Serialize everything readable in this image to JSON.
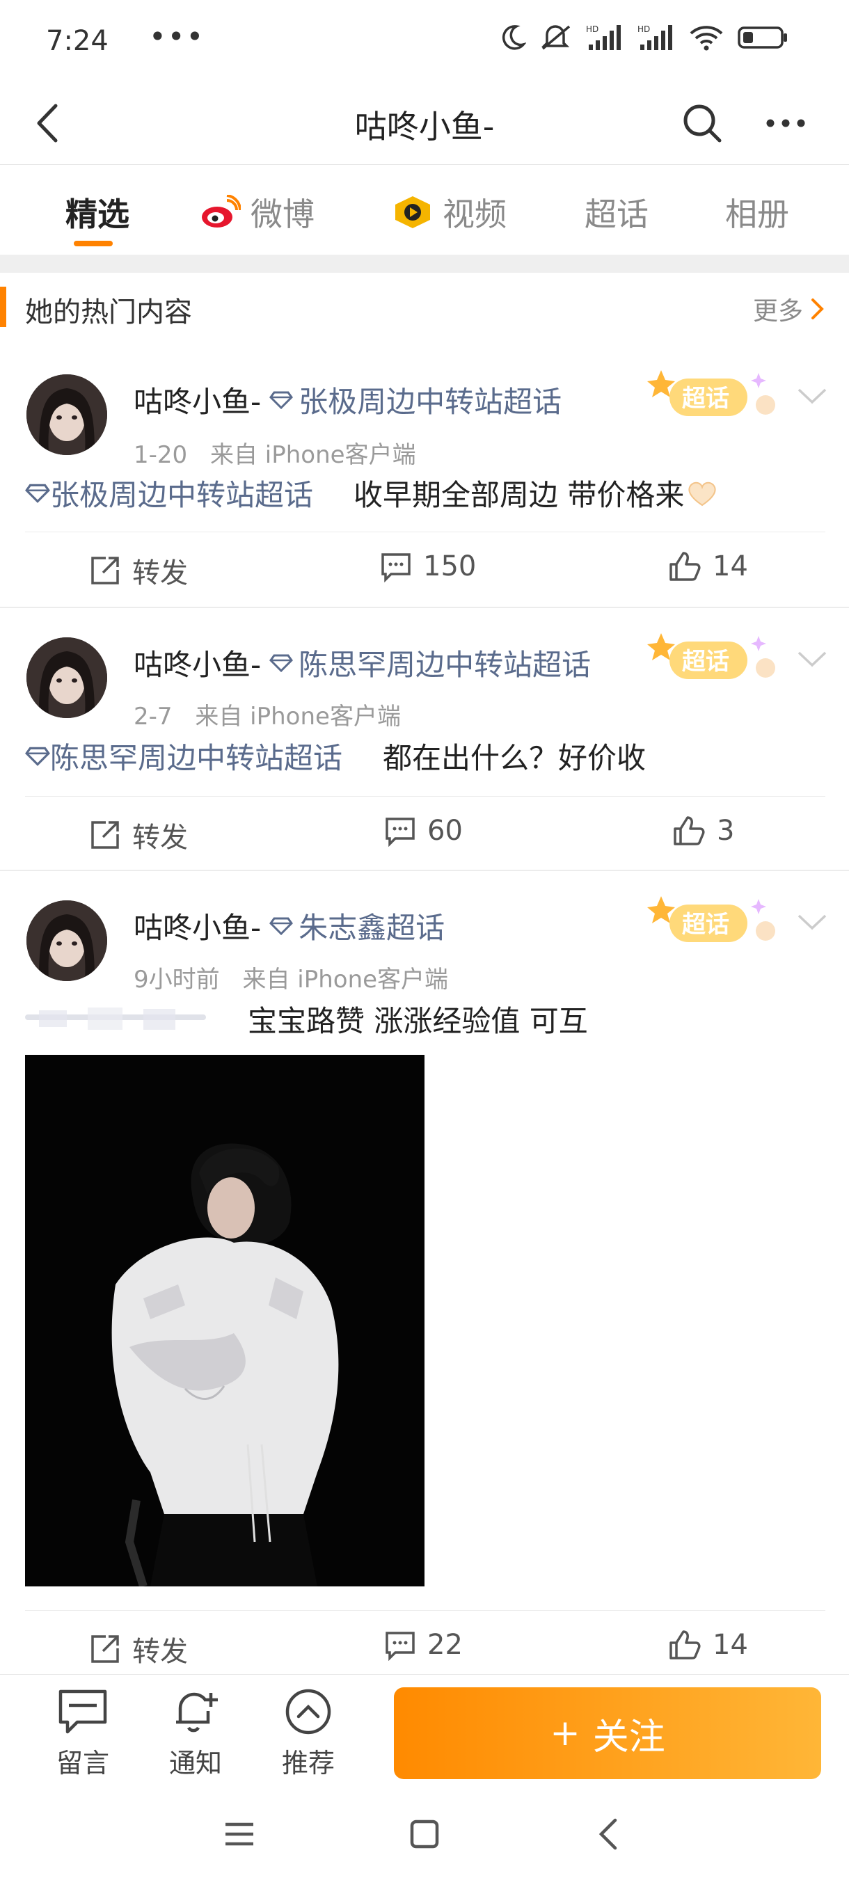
{
  "status": {
    "time": "7:24",
    "dots": "•••"
  },
  "header": {
    "title": "咕咚小鱼-"
  },
  "tabs": [
    {
      "label": "精选"
    },
    {
      "label": "微博"
    },
    {
      "label": "视频"
    },
    {
      "label": "超话"
    },
    {
      "label": "相册"
    }
  ],
  "section": {
    "title": "她的热门内容",
    "more": "更多"
  },
  "posts": [
    {
      "username": "咕咚小鱼-",
      "supertopic": "张极周边中转站超话",
      "date": "1-20",
      "source_prefix": "来自",
      "source": "iPhone客户端",
      "topic_link": "张极周边中转站超话",
      "text": "收早期全部周边 带价格来",
      "badge": "超话",
      "repost": "转发",
      "comments": "150",
      "likes": "14"
    },
    {
      "username": "咕咚小鱼-",
      "supertopic": "陈思罕周边中转站超话",
      "date": "2-7",
      "source_prefix": "来自",
      "source": "iPhone客户端",
      "topic_link": "陈思罕周边中转站超话",
      "text": "都在出什么？好价收",
      "badge": "超话",
      "repost": "转发",
      "comments": "60",
      "likes": "3"
    },
    {
      "username": "咕咚小鱼-",
      "supertopic": "朱志鑫超话",
      "date": "9小时前",
      "source_prefix": "来自",
      "source": "iPhone客户端",
      "text": "宝宝路赞 涨涨经验值 可互",
      "badge": "超话",
      "repost": "转发",
      "comments": "22",
      "likes": "14"
    }
  ],
  "bottom_bar": {
    "comment": "留言",
    "notify": "通知",
    "recommend": "推荐",
    "follow": "关注",
    "follow_plus": "+"
  },
  "colors": {
    "accent": "#ff8200",
    "link": "#5a6b8c"
  }
}
